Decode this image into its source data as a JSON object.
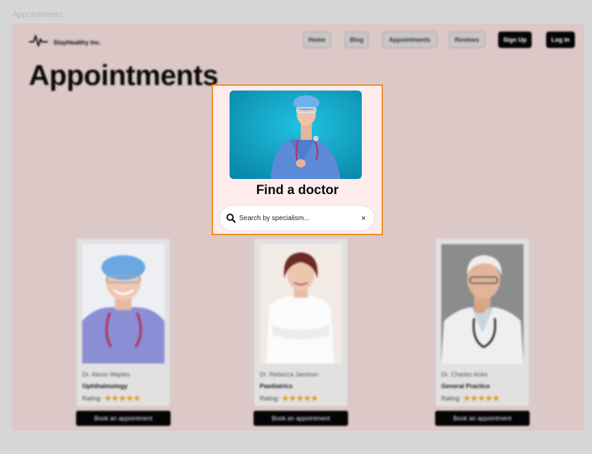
{
  "frame_label": "Appointments",
  "brand": {
    "name": "StayHealthy Inc.",
    "logo_icon": "heartbeat-icon"
  },
  "nav": {
    "home": "Home",
    "blog": "Blog",
    "appointments": "Appointments",
    "reviews": "Reviews",
    "sign_up": "Sign Up",
    "log_in": "Log In"
  },
  "page_title": "Appointments",
  "doctors": [
    {
      "name": "Dr. Alexis Waples",
      "specialty": "Ophthalmology",
      "rating_label": "Rating:",
      "stars": "★★★★★",
      "rating": 5,
      "book_label": "Book an appointment"
    },
    {
      "name": "Dr. Rebecca Jamison",
      "specialty": "Paediatrics",
      "rating_label": "Rating:",
      "stars": "★★★★★",
      "rating": 5,
      "book_label": "Book an appointment"
    },
    {
      "name": "Dr. Charles Anes",
      "specialty": "General Practice",
      "rating_label": "Rating:",
      "stars": "★★★★★",
      "rating": 5,
      "book_label": "Book an appointment"
    }
  ],
  "popup": {
    "title": "Find a doctor",
    "search_placeholder": "Search by specialism...",
    "clear_symbol": "×"
  },
  "colors": {
    "canvas_bg": "#dcc9c7",
    "popup_border": "#ee8c25",
    "popup_bg": "#fdeceb",
    "primary_button": "#050505",
    "star": "#d79d1a"
  }
}
